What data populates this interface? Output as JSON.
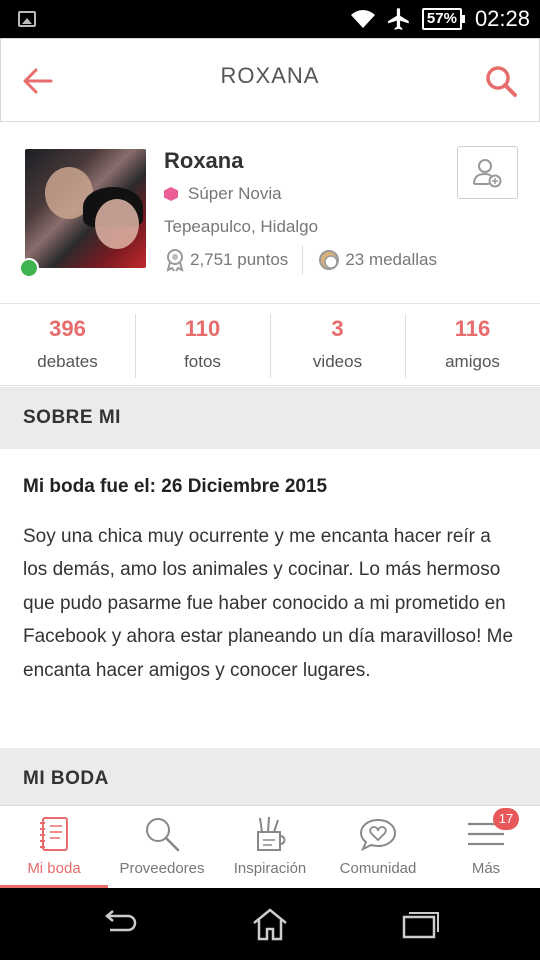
{
  "status_bar": {
    "battery": "57%",
    "time": "02:28"
  },
  "header": {
    "title": "ROXANA"
  },
  "profile": {
    "name": "Roxana",
    "rank": "Súper Novia",
    "location": "Tepeapulco, Hidalgo",
    "points": "2,751 puntos",
    "medals": "23 medallas"
  },
  "counters": [
    {
      "value": "396",
      "label": "debates"
    },
    {
      "value": "110",
      "label": "fotos"
    },
    {
      "value": "3",
      "label": "videos"
    },
    {
      "value": "116",
      "label": "amigos"
    }
  ],
  "about": {
    "section_title": "SOBRE MI",
    "wedding_date": "Mi boda fue el: 26 Diciembre 2015",
    "bio": "Soy una chica muy ocurrente y me encanta hacer reír a los demás, amo los animales y cocinar. Lo más hermoso que pudo pasarme fue haber conocido a mi prometido en Facebook y ahora estar planeando un día maravilloso! Me encanta hacer amigos y conocer lugares."
  },
  "my_wedding": {
    "section_title": "MI BODA"
  },
  "bottom_nav": [
    {
      "label": "Mi boda",
      "icon": "notebook-icon",
      "active": true
    },
    {
      "label": "Proveedores",
      "icon": "search-icon",
      "active": false
    },
    {
      "label": "Inspiración",
      "icon": "pencil-cup-icon",
      "active": false
    },
    {
      "label": "Comunidad",
      "icon": "heart-chat-icon",
      "active": false
    },
    {
      "label": "Más",
      "icon": "menu-icon",
      "active": false,
      "badge": "17"
    }
  ],
  "colors": {
    "accent": "#e86c6c",
    "online": "#3fb34f",
    "rank": "#ea5d97"
  }
}
